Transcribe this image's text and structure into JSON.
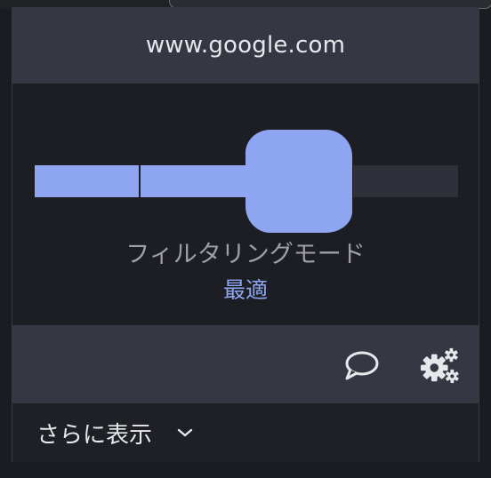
{
  "header": {
    "domain": "www.google.com"
  },
  "filter": {
    "label": "フィルタリングモード",
    "value": "最適",
    "level": 3,
    "levels": 4
  },
  "toolbar": {
    "feedback_icon": "speech-bubble-icon",
    "settings_icon": "gears-icon"
  },
  "footer": {
    "more_label": "さらに表示",
    "more_icon": "chevron-down-icon"
  },
  "colors": {
    "accent": "#8ea6f1",
    "header_bg": "#353743",
    "panel_bg": "#1d1e23",
    "inactive_segment": "#2e2f38"
  }
}
